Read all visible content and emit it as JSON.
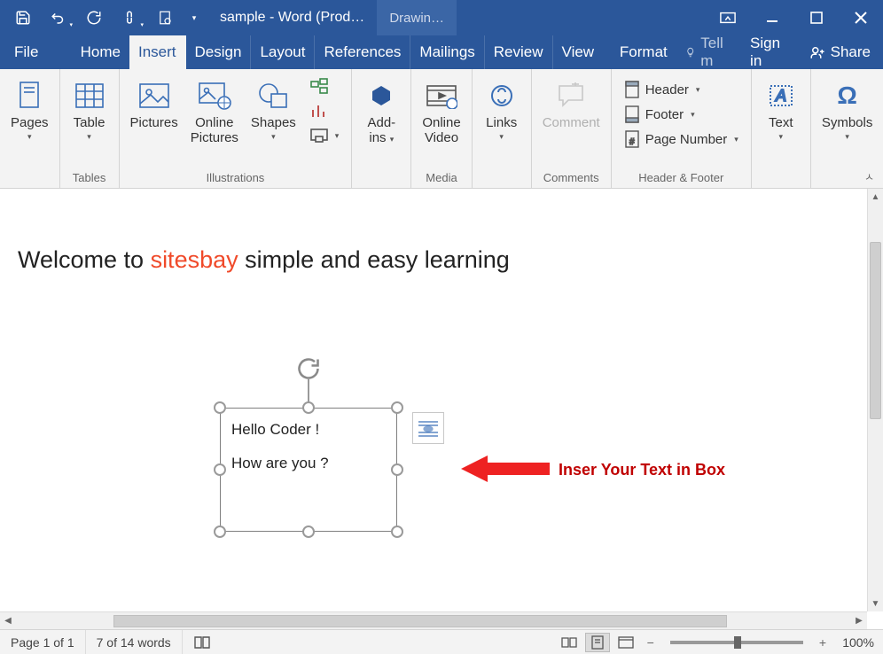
{
  "title": "sample - Word (Prod…",
  "contextual_tab": "Drawin…",
  "menu": {
    "file": "File",
    "home": "Home",
    "insert": "Insert",
    "design": "Design",
    "layout": "Layout",
    "references": "References",
    "mailings": "Mailings",
    "review": "Review",
    "view": "View",
    "format": "Format",
    "tellme": "Tell m",
    "signin": "Sign in",
    "share": "Share"
  },
  "ribbon": {
    "pages": "Pages",
    "table": "Table",
    "pictures": "Pictures",
    "online_pictures_l1": "Online",
    "online_pictures_l2": "Pictures",
    "shapes": "Shapes",
    "addins_l1": "Add-",
    "addins_l2": "ins",
    "online_video_l1": "Online",
    "online_video_l2": "Video",
    "links": "Links",
    "comment": "Comment",
    "header": "Header",
    "footer": "Footer",
    "page_number": "Page Number",
    "text_l1": "Text",
    "symbols": "Symbols",
    "group_tables": "Tables",
    "group_illustrations": "Illustrations",
    "group_media": "Media",
    "group_comments": "Comments",
    "group_header_footer": "Header & Footer"
  },
  "document": {
    "heading_pre": "Welcome to ",
    "heading_accent": "sitesbay",
    "heading_post": " simple and easy learning",
    "textbox_line1": "Hello Coder !",
    "textbox_line2": "How are you ?",
    "annotation": "Inser Your Text in Box"
  },
  "status": {
    "page": "Page 1 of 1",
    "words": "7 of 14 words",
    "zoom": "100%"
  }
}
